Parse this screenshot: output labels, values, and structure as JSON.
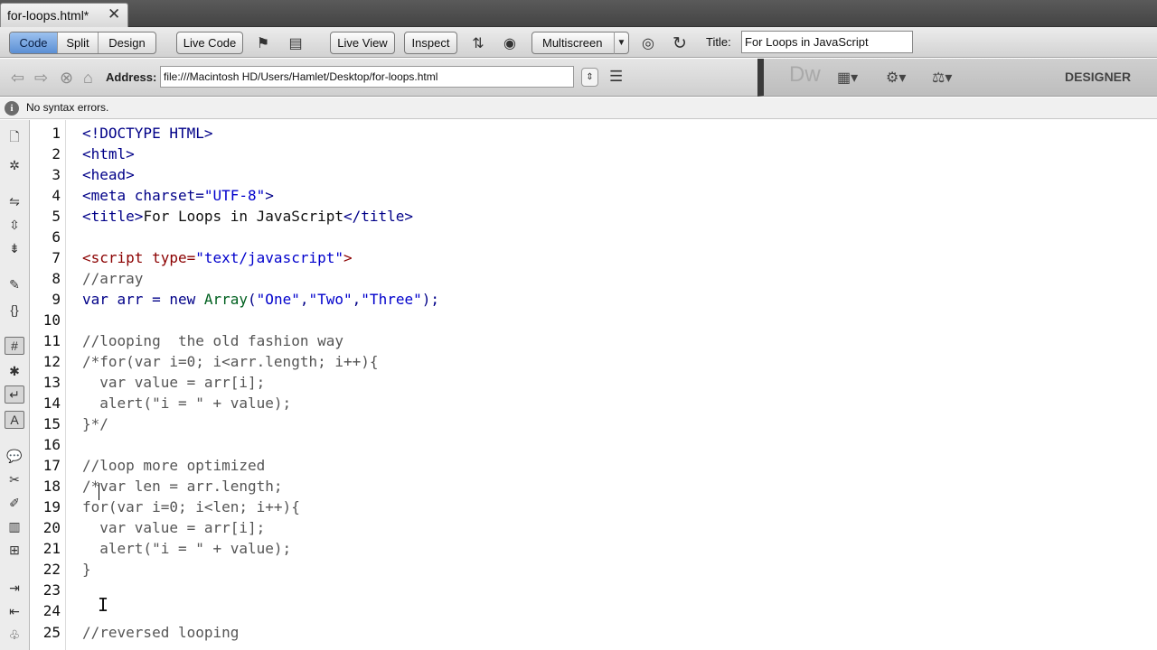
{
  "tab": {
    "label": "for-loops.html*",
    "close": "✕"
  },
  "toolbar": {
    "view_modes": [
      "Code",
      "Split",
      "Design"
    ],
    "live_code": "Live Code",
    "live_view": "Live View",
    "inspect": "Inspect",
    "multiscreen": "Multiscreen",
    "title_label": "Title:",
    "title_value": "For Loops in JavaScript"
  },
  "address": {
    "label": "Address:",
    "value": "file:///Macintosh HD/Users/Hamlet/Desktop/for-loops.html"
  },
  "appbar": {
    "logo": "Dw",
    "workspace": "DESIGNER"
  },
  "status": {
    "text": "No syntax errors."
  },
  "colors": {
    "active_mode": "#5b8fd4",
    "tag": "#000088",
    "script_tag": "#8b0000",
    "string": "#0000cc"
  },
  "code_lines": [
    {
      "n": "1",
      "t": "<!DOCTYPE HTML>"
    },
    {
      "n": "2",
      "t": "<html>"
    },
    {
      "n": "3",
      "t": "<head>"
    },
    {
      "n": "4",
      "a": "<meta charset=",
      "b": "\"UTF-8\"",
      "c": ">"
    },
    {
      "n": "5",
      "a": "<title>",
      "b": "For Loops in JavaScript",
      "c": "</title>"
    },
    {
      "n": "6",
      "t": ""
    },
    {
      "n": "7",
      "a": "<script type=",
      "b": "\"text/javascript\"",
      "c": ">"
    },
    {
      "n": "8",
      "t": "//array"
    },
    {
      "n": "9",
      "a": "var arr = new ",
      "b": "Array",
      "c": "(",
      "d": "\"One\"",
      "e": ",",
      "f": "\"Two\"",
      "g": ",",
      "h": "\"Three\"",
      "i": ");"
    },
    {
      "n": "10",
      "t": ""
    },
    {
      "n": "11",
      "t": "//looping  the old fashion way"
    },
    {
      "n": "12",
      "t": "/*for(var i=0; i<arr.length; i++){"
    },
    {
      "n": "13",
      "t": "  var value = arr[i];"
    },
    {
      "n": "14",
      "t": "  alert(\"i = \" + value);"
    },
    {
      "n": "15",
      "t": "}*/"
    },
    {
      "n": "16",
      "t": ""
    },
    {
      "n": "17",
      "t": "//loop more optimized"
    },
    {
      "n": "18",
      "t": "/*var len = arr.length;"
    },
    {
      "n": "19",
      "t": "for(var i=0; i<len; i++){"
    },
    {
      "n": "20",
      "t": "  var value = arr[i];"
    },
    {
      "n": "21",
      "t": "  alert(\"i = \" + value);"
    },
    {
      "n": "22",
      "t": "}"
    },
    {
      "n": "23",
      "t": ""
    },
    {
      "n": "24",
      "t": ""
    },
    {
      "n": "25",
      "t": "//reversed looping"
    }
  ]
}
